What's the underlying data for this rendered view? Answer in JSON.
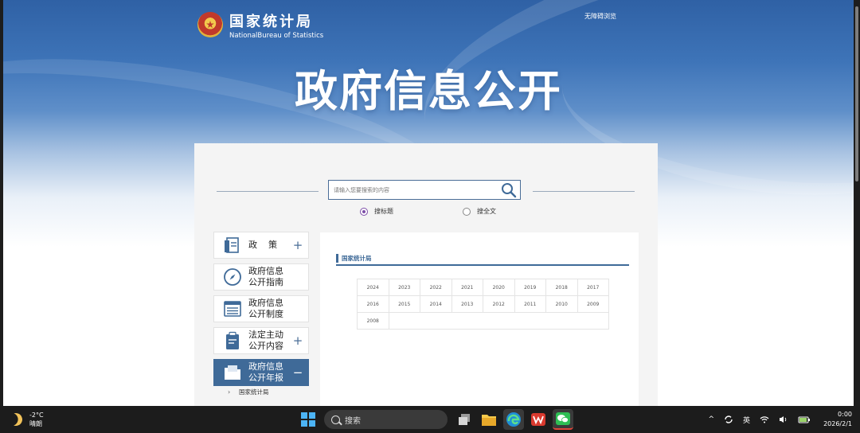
{
  "header": {
    "site_name": "国家统计局",
    "site_name_en": "NationalBureau of Statistics",
    "accessibility_link": "无障碍浏览",
    "banner_title": "政府信息公开"
  },
  "search": {
    "placeholder": "请输入您要搜索的内容",
    "value": "",
    "options": [
      {
        "label": "搜标题",
        "selected": true
      },
      {
        "label": "搜全文",
        "selected": false
      }
    ]
  },
  "sidebar": {
    "items": [
      {
        "label": "政策",
        "icon": "document-icon",
        "toggle": "+"
      },
      {
        "label": "政府信息\n公开指南",
        "icon": "compass-icon",
        "toggle": ""
      },
      {
        "label": "政府信息\n公开制度",
        "icon": "list-icon",
        "toggle": ""
      },
      {
        "label": "法定主动\n公开内容",
        "icon": "clipboard-icon",
        "toggle": "+"
      },
      {
        "label": "政府信息\n公开年报",
        "icon": "folder-icon",
        "toggle": "−",
        "active": true
      }
    ],
    "sub_items": [
      {
        "label": "国家统计局"
      }
    ]
  },
  "content": {
    "section_title": "国家统计局",
    "years": [
      [
        "2024",
        "2023",
        "2022",
        "2021",
        "2020",
        "2019",
        "2018",
        "2017"
      ],
      [
        "2016",
        "2015",
        "2014",
        "2013",
        "2012",
        "2011",
        "2010",
        "2009"
      ],
      [
        "2008"
      ]
    ]
  },
  "taskbar": {
    "weather_temp": "-2°C",
    "weather_desc": "晴朗",
    "search_label": "搜索",
    "ime": "英",
    "time": "0:00",
    "date": "2026/2/1"
  },
  "colors": {
    "accent": "#3f6a98",
    "radio_selected": "#7d4ea8",
    "banner_top": "#2f61a5"
  }
}
